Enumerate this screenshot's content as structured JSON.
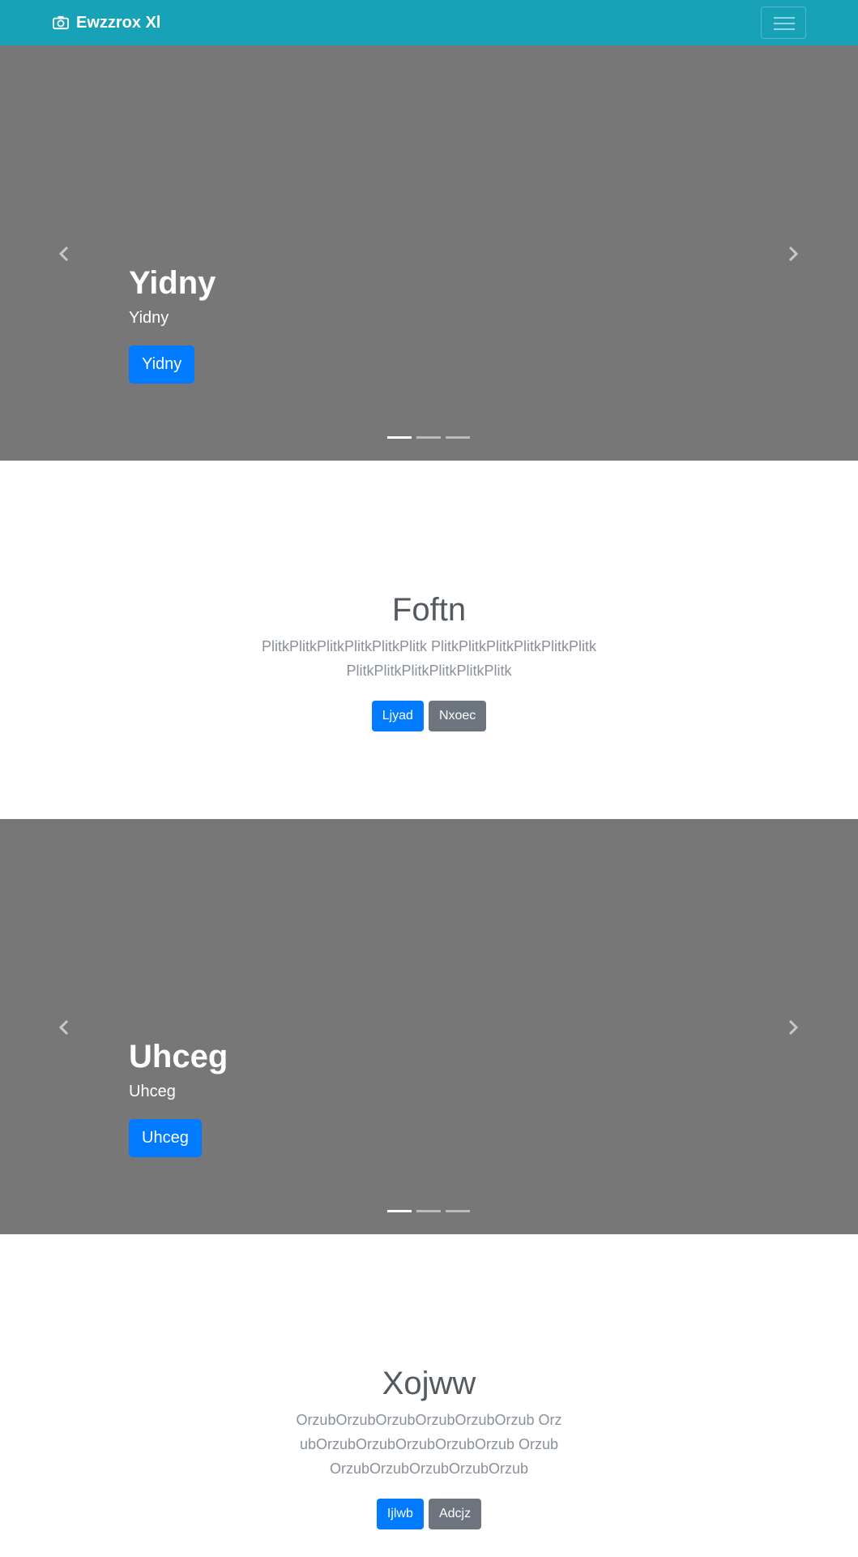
{
  "navbar": {
    "brand": "Ewzzrox Xl",
    "brand_icon": "camera-icon",
    "toggler_icon": "hamburger-icon",
    "background": "#17a2b8"
  },
  "carousel_1": {
    "title": "Yidny",
    "subtitle": "Yidny",
    "button": "Yidny",
    "indicators": 3,
    "active_indicator": 0
  },
  "section_1": {
    "heading": "Foftn",
    "lead": "PlitkPlitkPlitkPlitkPlitkPlitk PlitkPlitkPlitkPlitkPlitkPlitk PlitkPlitkPlitkPlitkPlitkPlitk",
    "primary_button": "Ljyad",
    "secondary_button": "Nxoec"
  },
  "carousel_2": {
    "title": "Uhceg",
    "subtitle": "Uhceg",
    "button": "Uhceg",
    "indicators": 3,
    "active_indicator": 0
  },
  "section_2": {
    "heading": "Xojww",
    "lead": "OrzubOrzubOrzubOrzubOrzubOrzub OrzubOrzubOrzubOrzubOrzubOrzub OrzubOrzubOrzubOrzubOrzubOrzub",
    "primary_button": "Ijlwb",
    "secondary_button": "Adcjz"
  },
  "colors": {
    "accent": "#007bff",
    "secondary": "#6c757d",
    "carousel_bg": "#777777"
  }
}
